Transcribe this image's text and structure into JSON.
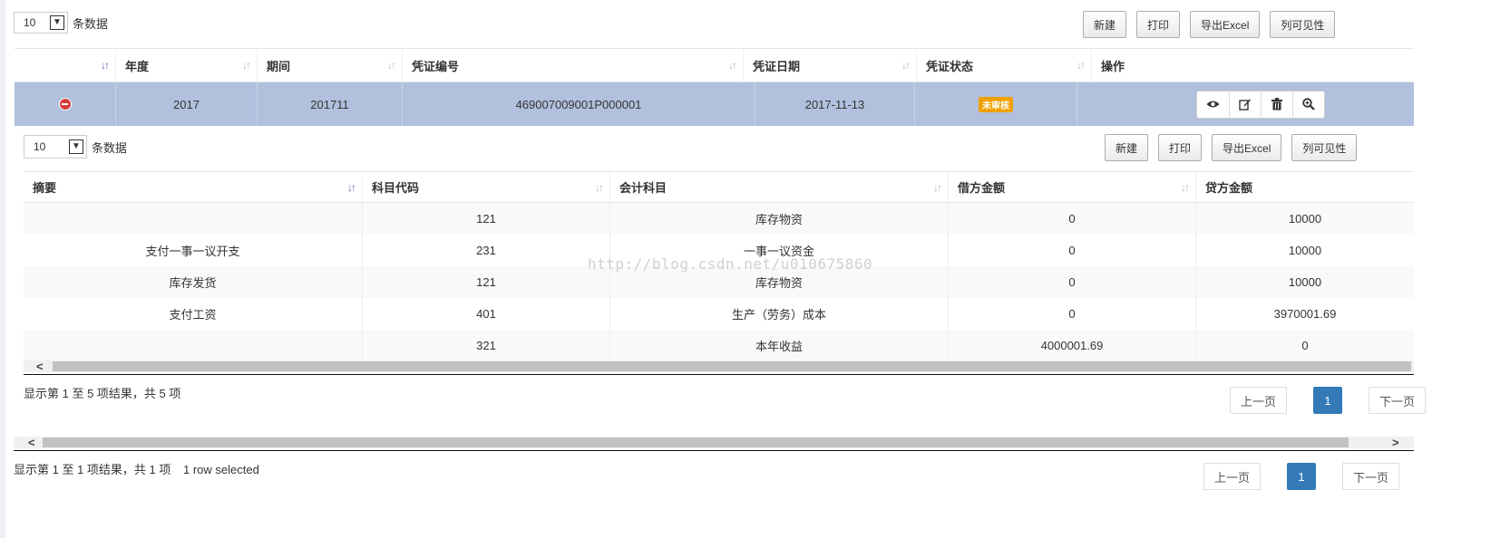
{
  "outer": {
    "length": {
      "value": "10",
      "label": "条数据"
    },
    "buttons": {
      "new": "新建",
      "print": "打印",
      "export": "导出Excel",
      "columns": "列可见性"
    },
    "columns": [
      "年度",
      "期间",
      "凭证编号",
      "凭证日期",
      "凭证状态",
      "操作"
    ],
    "row": {
      "year": "2017",
      "period": "201711",
      "voucher_no": "469007009001P000001",
      "date": "2017-11-13",
      "status": "未审核"
    },
    "info": "显示第 1 至 1 项结果，共 1 项",
    "selected": "1 row selected",
    "pager": {
      "prev": "上一页",
      "current": "1",
      "next": "下一页"
    }
  },
  "inner": {
    "length": {
      "value": "10",
      "label": "条数据"
    },
    "buttons": {
      "new": "新建",
      "print": "打印",
      "export": "导出Excel",
      "columns": "列可见性"
    },
    "columns": [
      "摘要",
      "科目代码",
      "会计科目",
      "借方金额",
      "贷方金额"
    ],
    "rows": [
      {
        "summary": "",
        "code": "121",
        "account": "库存物资",
        "debit": "0",
        "credit": "10000"
      },
      {
        "summary": "支付一事一议开支",
        "code": "231",
        "account": "一事一议资金",
        "debit": "0",
        "credit": "10000"
      },
      {
        "summary": "库存发货",
        "code": "121",
        "account": "库存物资",
        "debit": "0",
        "credit": "10000"
      },
      {
        "summary": "支付工资",
        "code": "401",
        "account": "生产（劳务）成本",
        "debit": "0",
        "credit": "3970001.69"
      },
      {
        "summary": "",
        "code": "321",
        "account": "本年收益",
        "debit": "4000001.69",
        "credit": "0"
      }
    ],
    "info": "显示第 1 至 5 项结果，共 5 项",
    "pager": {
      "prev": "上一页",
      "current": "1",
      "next": "下一页"
    }
  },
  "watermark": "http://blog.csdn.net/u010675860",
  "icons": {
    "view": "eye-icon",
    "edit": "edit-icon",
    "delete": "trash-icon",
    "zoom": "zoom-icon",
    "collapse": "minus-circle-icon"
  },
  "colors": {
    "selected_row": "#b0c0dd",
    "status_badge": "#f0a000",
    "pager_active": "#337ab7",
    "collapse": "#d43f3a"
  }
}
